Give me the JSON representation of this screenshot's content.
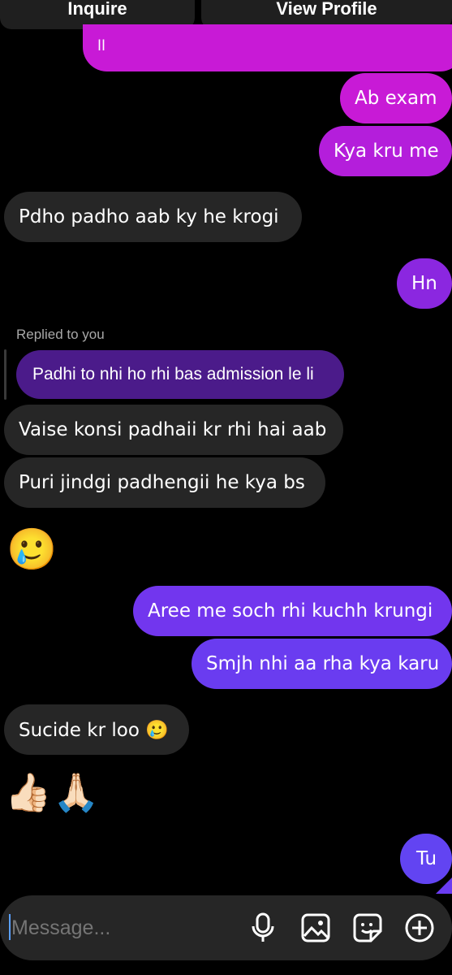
{
  "header": {
    "inquire_label": "Inquire",
    "view_profile_label": "View Profile"
  },
  "messages": {
    "partial_top": "ll",
    "sent_ab_exam": "Ab exam",
    "sent_kya_kru_me": "Kya kru me",
    "recv_pdho_padho": "Pdho padho aab ky he krogi",
    "sent_hn": "Hn",
    "reply_label": "Replied to you",
    "reply_quote": "Padhi to nhi ho rhi bas admission le li",
    "recv_vaise_konsi": "Vaise konsi padhaii kr rhi hai aab",
    "recv_puri_jindgi": "Puri jindgi padhengii he kya bs",
    "recv_emoji_crying": "🥲",
    "sent_aree_me_soch": "Aree me soch rhi kuchh krungi",
    "sent_smjh_nhi": "Smjh nhi aa rha kya karu",
    "recv_sucide": "Sucide kr loo 🥲",
    "recv_emoji_reaction": "👍🏻🙏🏻",
    "sent_tu": "Tu"
  },
  "composer": {
    "placeholder": "Message..."
  },
  "icons": {
    "mic": "microphone-icon",
    "gallery": "image-icon",
    "sticker": "sticker-icon",
    "add": "plus-circle-icon"
  },
  "colors": {
    "background": "#000000",
    "received_bubble": "#262626",
    "sent_magenta": "#c81ad6",
    "sent_purple": "#8b27e0",
    "sent_violet": "#6a3cf0",
    "reply_quote_bg": "#4b1b8a",
    "composer_bg": "#262626"
  }
}
